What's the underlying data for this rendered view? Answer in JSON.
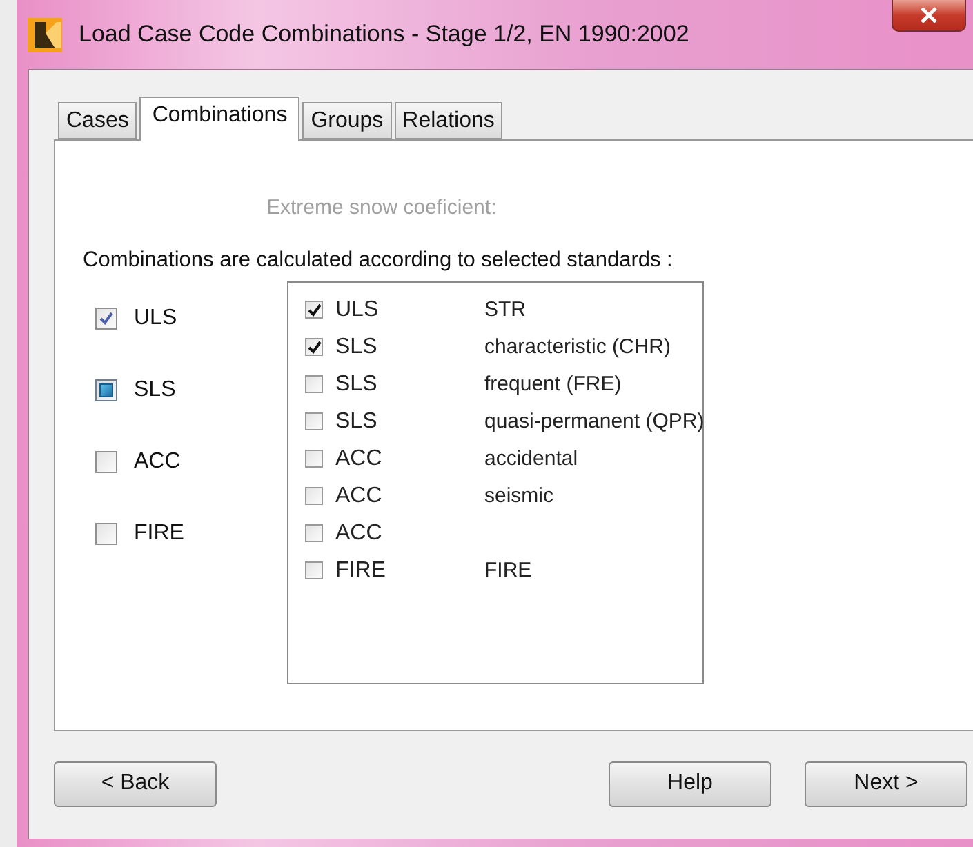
{
  "window": {
    "title": "Load Case Code Combinations - Stage 1/2, EN 1990:2002"
  },
  "tabs": [
    {
      "label": "Cases",
      "selected": false
    },
    {
      "label": "Combinations",
      "selected": true
    },
    {
      "label": "Groups",
      "selected": false
    },
    {
      "label": "Relations",
      "selected": false
    }
  ],
  "snow_label": {
    "text": "Extreme snow coeficient:",
    "disabled": true
  },
  "standards_label": "Combinations are calculated according to selected standards :",
  "standards": [
    {
      "label": "ULS",
      "checked": true,
      "mixed": false
    },
    {
      "label": "SLS",
      "checked": false,
      "mixed": true
    },
    {
      "label": "ACC",
      "checked": false,
      "mixed": false
    },
    {
      "label": "FIRE",
      "checked": false,
      "mixed": false
    }
  ],
  "combinations": [
    {
      "standard": "ULS",
      "type": "STR",
      "checked": true
    },
    {
      "standard": "SLS",
      "type": "characteristic (CHR)",
      "checked": true
    },
    {
      "standard": "SLS",
      "type": "frequent (FRE)",
      "checked": false
    },
    {
      "standard": "SLS",
      "type": "quasi-permanent (QPR)",
      "checked": false
    },
    {
      "standard": "ACC",
      "type": "accidental",
      "checked": false
    },
    {
      "standard": "ACC",
      "type": "seismic",
      "checked": false
    },
    {
      "standard": "ACC",
      "checked": false
    },
    {
      "standard": "FIRE",
      "type": "FIRE",
      "checked": false
    }
  ],
  "buttons": {
    "back": "< Back",
    "help": "Help",
    "next": "Next >"
  }
}
